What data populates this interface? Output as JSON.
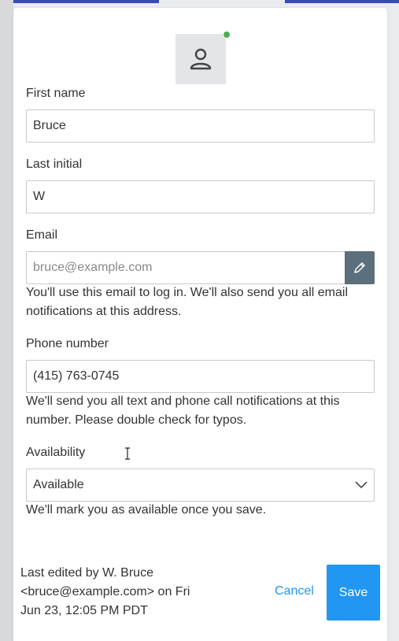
{
  "profile": {
    "avatar_icon": "person-icon",
    "status_color": "#4caf50"
  },
  "form": {
    "first_name": {
      "label": "First name",
      "value": "Bruce"
    },
    "last_initial": {
      "label": "Last initial",
      "value": "W"
    },
    "email": {
      "label": "Email",
      "placeholder": "bruce@example.com",
      "help": "You'll use this email to log in. We'll also send you all email notifications at this address.",
      "edit_icon": "pencil-icon"
    },
    "phone": {
      "label": "Phone number",
      "value": "(415) 763-0745",
      "help": "We'll send you all text and phone call notifications at this number. Please double check for typos."
    },
    "availability": {
      "label": "Availability",
      "selected": "Available",
      "help": "We'll mark you as available once you save."
    }
  },
  "footer": {
    "last_edited": "Last edited by W. Bruce <bruce@example.com> on Fri Jun 23, 12:05 PM PDT",
    "cancel_label": "Cancel",
    "save_label": "Save"
  },
  "colors": {
    "accent": "#2196f3",
    "edit_button": "#5b6f7c",
    "top_bar": "#3a4bb8"
  }
}
